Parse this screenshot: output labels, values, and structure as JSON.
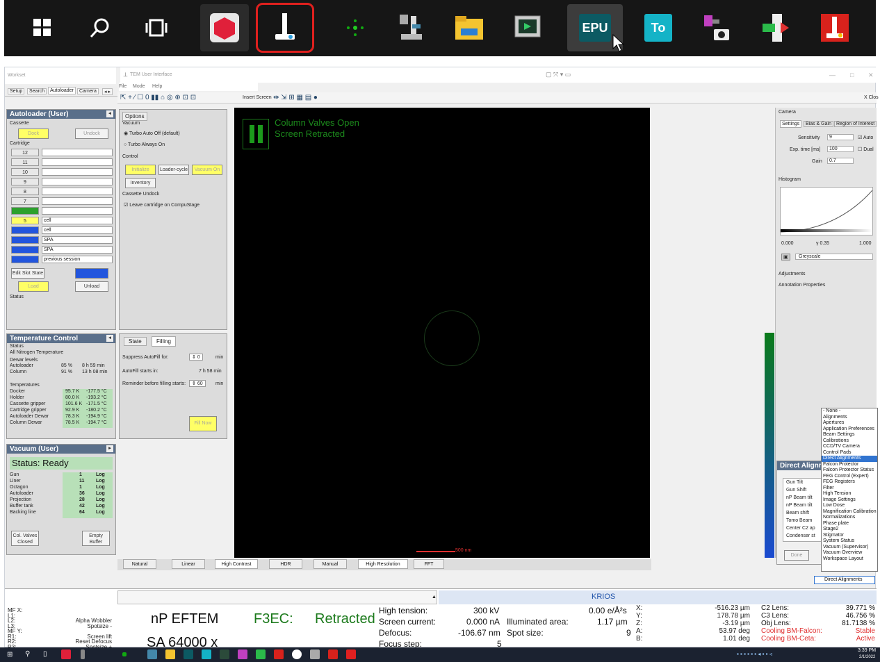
{
  "zoom_taskbar": {
    "epu": "EPU",
    "to": "To"
  },
  "window": {
    "left_title": "Workset",
    "left_tabs": [
      "Setup",
      "Search",
      "Autoloader",
      "Camera"
    ],
    "tem_title": "TEM User Interface",
    "menu": [
      "File",
      "Mode",
      "Help"
    ],
    "insert_screen": "Insert Screen",
    "close_label": "X Clos"
  },
  "autoloader": {
    "title": "Autoloader (User)",
    "cassette": "Cassette",
    "dock": "Dock",
    "undock": "Undock",
    "cartridge": "Cartridge",
    "slots": [
      {
        "n": "12",
        "name": ""
      },
      {
        "n": "11",
        "name": ""
      },
      {
        "n": "10",
        "name": ""
      },
      {
        "n": "9",
        "name": ""
      },
      {
        "n": "8",
        "name": ""
      },
      {
        "n": "7",
        "name": ""
      },
      {
        "n": "",
        "name": ""
      },
      {
        "n": "5",
        "name": "cell"
      },
      {
        "n": "",
        "name": "cell"
      },
      {
        "n": "",
        "name": "SPA"
      },
      {
        "n": "",
        "name": "SPA"
      },
      {
        "n": "",
        "name": "previous session"
      }
    ],
    "edit_slot": "Edit Slot State",
    "load": "Load",
    "unload": "Unload",
    "status": "Status"
  },
  "options": {
    "title": "Options",
    "vacuum": "Vacuum",
    "turbo_auto": "Turbo Auto Off (default)",
    "turbo_on": "Turbo Always On",
    "control": "Control",
    "initialize": "Initialize",
    "loader_cycle": "Loader-cycle",
    "vacuum_on": "Vacuum On",
    "inventory": "Inventory",
    "cassette_undock": "Cassette Undock",
    "leave_cartridge": "Leave cartridge on CompuStage"
  },
  "temperature": {
    "title": "Temperature Control",
    "status": "Status",
    "status_value": "All Nitrogen Temperature",
    "dewar_levels": "Dewar levels",
    "dewars": [
      {
        "name": "Autoloader",
        "pct": "85 %",
        "time": "8 h 59 min"
      },
      {
        "name": "Column",
        "pct": "91 %",
        "time": "13 h 08 min"
      }
    ],
    "temps_label": "Temperatures",
    "temps": [
      {
        "name": "Docker",
        "k": "95.7 K",
        "c": "-177.5 °C"
      },
      {
        "name": "Holder",
        "k": "80.0 K",
        "c": "-193.2 °C"
      },
      {
        "name": "Cassette gripper",
        "k": "101.6 K",
        "c": "-171.5 °C"
      },
      {
        "name": "Cartridge gripper",
        "k": "92.9 K",
        "c": "-180.2 °C"
      },
      {
        "name": "Autoloader Dewar",
        "k": "78.3 K",
        "c": "-194.9 °C"
      },
      {
        "name": "Column Dewar",
        "k": "78.5 K",
        "c": "-194.7 °C"
      }
    ]
  },
  "filling": {
    "tabs": [
      "State",
      "Filling"
    ],
    "suppress": "Suppress AutoFill for:",
    "suppress_val": "0",
    "starts": "AutoFill starts in:",
    "starts_val": "7 h 58 min",
    "reminder": "Reminder before filling starts:",
    "reminder_val": "60",
    "min": "min",
    "fill_now": "Fill Now"
  },
  "vacuum": {
    "title": "Vacuum (User)",
    "status": "Status: Ready",
    "rows": [
      {
        "name": "Gun",
        "v": "1"
      },
      {
        "name": "Liner",
        "v": "11"
      },
      {
        "name": "Octagon",
        "v": "1"
      },
      {
        "name": "Autoloader",
        "v": "36"
      },
      {
        "name": "Projection",
        "v": "28"
      },
      {
        "name": "Buffer tank",
        "v": "42"
      },
      {
        "name": "Backing line",
        "v": "64"
      }
    ],
    "log": "Log",
    "col_valves": "Col. Valves Closed",
    "empty_buffer": "Empty Buffer"
  },
  "viewer": {
    "line1": "Column Valves Open",
    "line2": "Screen Retracted",
    "scale": "500 nm",
    "tabs": [
      "Natural",
      "Linear",
      "High Contrast",
      "HDR",
      "Manual",
      "High Resolution",
      "FFT"
    ]
  },
  "camera": {
    "title": "Camera",
    "tabs": [
      "Settings",
      "Bias & Gain",
      "Region of Interest"
    ],
    "sensitivity": "Sensitivity",
    "sens_val": "9",
    "auto": "Auto",
    "exp": "Exp. time [ms]",
    "exp_val": "100",
    "dual": "Dual",
    "gain": "Gain",
    "gain_val": "0.7",
    "histogram": "Histogram",
    "h_min": "0.000",
    "h_gamma": "γ 0.35",
    "h_max": "1.000",
    "greyscale": "Greyscale",
    "adjustments": "Adjustments",
    "annotation": "Annotation Properties"
  },
  "direct": {
    "title": "Direct Alignm",
    "items": [
      "Gun Tilt",
      "Gun Shift",
      "nP Beam tilt",
      "nP Beam tilt",
      "Beam shift",
      "Tomo Beam",
      "Center C2 ap",
      "Condenser st"
    ],
    "done": "Done",
    "dropdown": [
      "- None -",
      "Alignments",
      "Apertures",
      "Application Preferences",
      "Beam Settings",
      "Calibrations",
      "CCD/TV Camera",
      "Control Pads",
      "Direct Alignments",
      "Falcon Protector",
      "Falcon Protector Status",
      "FEG Control (Expert)",
      "FEG Registers",
      "Filter",
      "High Tension",
      "Image Settings",
      "Low Dose",
      "Magnification Calibration",
      "Normalizations",
      "Phase plate",
      "Stage2",
      "Stigmator",
      "System Status",
      "Vacuum (Supervisor)",
      "Vacuum Overview",
      "Workspace Layout"
    ],
    "selected": "Direct Alignments",
    "combo": "Direct Alignments"
  },
  "status": {
    "krios": "KRIOS",
    "left_keys": [
      "MF X:",
      "L1:",
      "L2:",
      "L3:",
      "MF Y:",
      "R1:",
      "R2:",
      "R3:"
    ],
    "left_vals": [
      "",
      "",
      "Alpha Wobbler",
      "Spotsize -",
      "",
      "Screen lift",
      "Reset Defocus",
      "Spotsize +"
    ],
    "mode": "nP EFTEM",
    "mag": "SA 64000 x",
    "f3ec": "F3EC:",
    "retracted": "Retracted",
    "ht_l": "High tension:",
    "ht_v": "300 kV",
    "sc_l": "Screen current:",
    "sc_v": "0.000 nA",
    "df_l": "Defocus:",
    "df_v": "-106.67 nm",
    "fs_l": "Focus step:",
    "fs_v": "5",
    "dose": "0.00 e/Å²s",
    "ia_l": "Illuminated area:",
    "ia_v": "1.17 µm",
    "ss_l": "Spot size:",
    "ss_v": "9",
    "axes": [
      "X:",
      "Y:",
      "Z:",
      "A:",
      "B:"
    ],
    "axis_vals": [
      "-516.23 µm",
      "178.78 µm",
      "-3.19 µm",
      "53.97 deg",
      "1.01 deg"
    ],
    "lens_l": [
      "C2 Lens:",
      "C3 Lens:",
      "Obj Lens:",
      "Cooling BM-Falcon:",
      "Cooling BM-Ceta:"
    ],
    "lens_v": [
      "39.771 %",
      "46.756 %",
      "81.7138 %",
      "Stable",
      "Active"
    ]
  },
  "tray": {
    "time": "3:39 PM",
    "date": "2/1/2022"
  },
  "colors": {
    "green": "#00cc00",
    "blue": "#2255dd",
    "yellow": "#ffff66"
  }
}
